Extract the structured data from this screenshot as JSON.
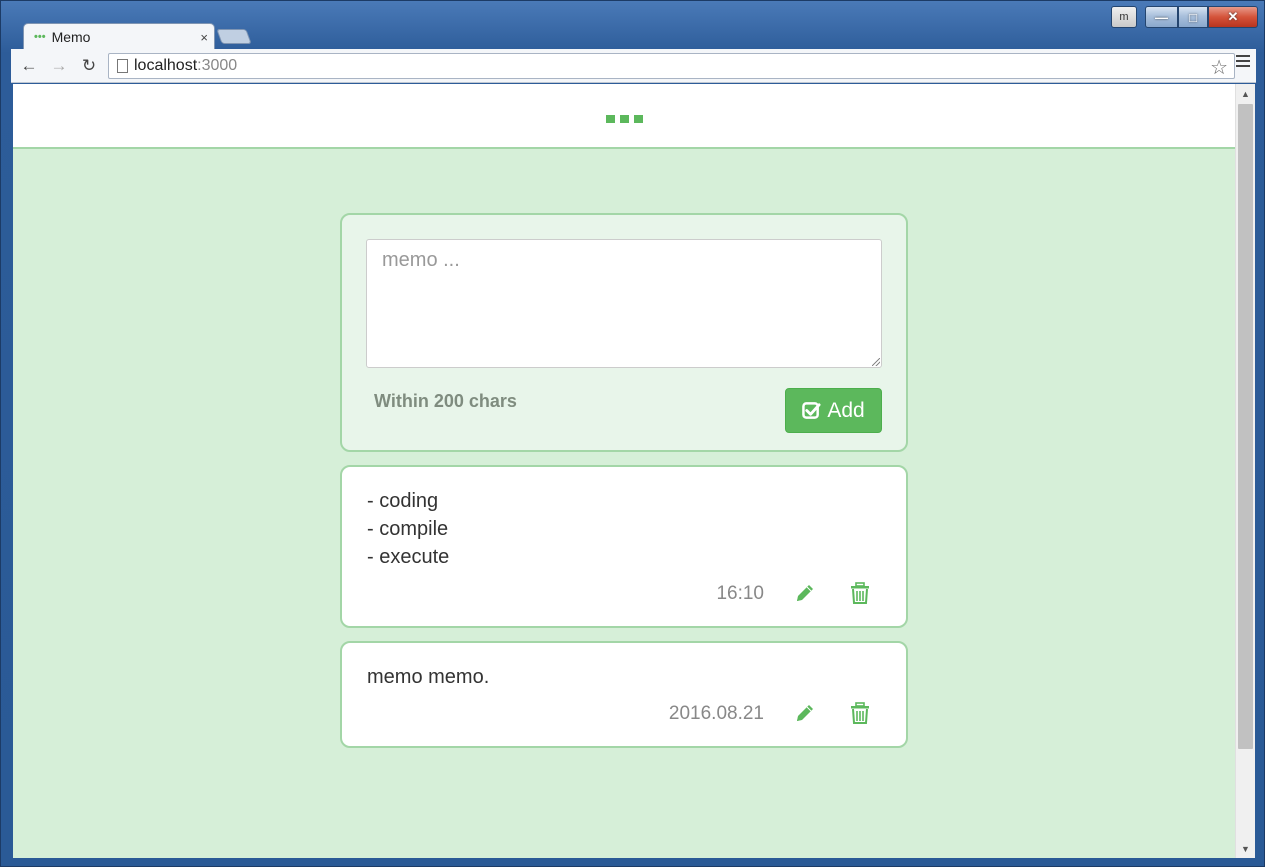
{
  "window": {
    "user_badge": "m",
    "min_glyph": "—",
    "max_glyph": "□",
    "close_glyph": "✕"
  },
  "tab": {
    "favicon": "•••",
    "title": "Memo",
    "close_glyph": "×"
  },
  "toolbar": {
    "back_glyph": "←",
    "forward_glyph": "→",
    "reload_glyph": "↻",
    "url_host": "localhost",
    "url_port": ":3000",
    "star_glyph": "☆"
  },
  "form": {
    "placeholder": "memo ...",
    "value": "",
    "char_limit_label": "Within 200 chars",
    "add_label": "Add"
  },
  "memos": [
    {
      "text": "- coding\n- compile\n- execute",
      "time": "16:10"
    },
    {
      "text": "memo memo.",
      "time": "2016.08.21"
    }
  ],
  "scrollbar": {
    "up_glyph": "▲",
    "down_glyph": "▼"
  },
  "colors": {
    "accent": "#5cb85c",
    "page_bg": "#d6efd8",
    "card_border": "#a3d6a7"
  },
  "icons": {
    "logo": "three-dots-logo",
    "add": "check-square-icon",
    "edit": "pencil-icon",
    "delete": "trash-icon"
  }
}
